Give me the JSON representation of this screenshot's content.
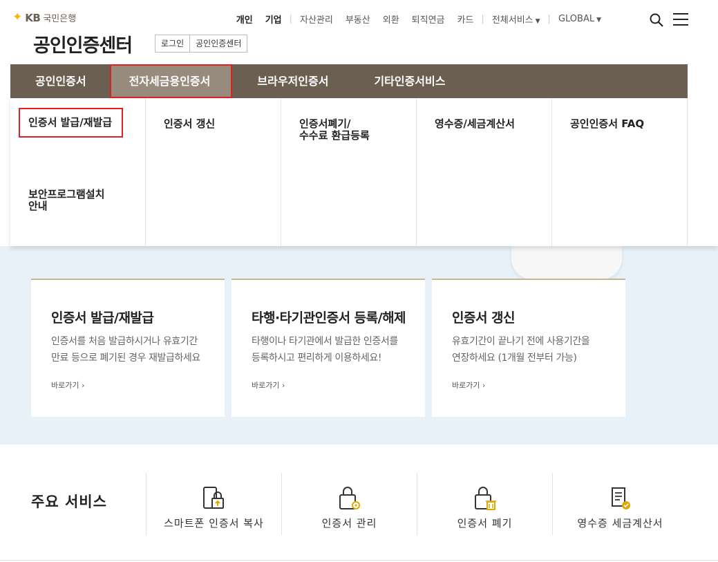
{
  "logo": {
    "mark": "KB",
    "text": "국민은행"
  },
  "top_nav": {
    "personal": "개인",
    "business": "기업",
    "asset": "자산관리",
    "realty": "부동산",
    "fx": "외환",
    "pension": "퇴직연금",
    "card": "카드",
    "all_services": "전체서비스",
    "global": "GLOBAL"
  },
  "page_title": "공인인증센터",
  "breadcrumb": [
    "로그인",
    "공인인증센터"
  ],
  "gnb": [
    "공인인증서",
    "전자세금용인증서",
    "브라우저인증서",
    "기타인증서비스"
  ],
  "dropdown": {
    "issue": "인증서 발급/재발급",
    "renew": "인증서 갱신",
    "revoke_line1": "인증서폐기/",
    "revoke_line2": "수수료 환급등록",
    "receipt": "영수증/세금계산서",
    "faq": "공인인증서 FAQ",
    "security_line1": "보안프로그램설치",
    "security_line2": "안내"
  },
  "cards": [
    {
      "title": "인증서 발급/재발급",
      "desc_line1": "인증서를 처음 발급하시거나 유효기간",
      "desc_line2": "만료 등으로 폐기된 경우 재발급하세요",
      "more": "바로가기"
    },
    {
      "title": "타행·타기관인증서 등록/해제",
      "desc_line1": "타행이나 타기관에서 발급한 인증서를",
      "desc_line2": "등록하시고 편리하게 이용하세요!",
      "more": "바로가기"
    },
    {
      "title": "인증서 갱신",
      "desc_line1": "유효기간이 끝나기 전에 사용기간을",
      "desc_line2": "연장하세요 (1개월 전부터 가능)",
      "more": "바로가기"
    }
  ],
  "services": {
    "title": "주요 서비스",
    "items": [
      "스마트폰 인증서 복사",
      "인증서 관리",
      "인증서 폐기",
      "영수증 세금계산서"
    ]
  },
  "colors": {
    "gnb": "#6b5f52",
    "gnb_active": "#978b7d",
    "accent": "#f5b800",
    "highlight": "#e02020",
    "hero_bg": "#e8f1f8"
  }
}
